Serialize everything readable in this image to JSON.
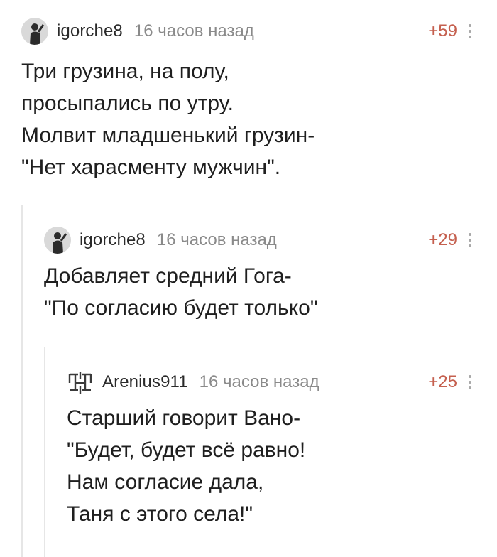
{
  "comments": [
    {
      "username": "igorche8",
      "time": "16 часов назад",
      "score": "+59",
      "avatar": "user-photo-avatar",
      "lines": [
        "Три грузина, на полу,",
        "просыпались по утру.",
        "Молвит младшенький грузин-",
        "\"Нет харасменту мужчин\"."
      ]
    },
    {
      "username": "igorche8",
      "time": "16 часов назад",
      "score": "+29",
      "avatar": "user-photo-avatar",
      "lines": [
        "Добавляет средний Гога-",
        "\"По согласию будет только\""
      ]
    },
    {
      "username": "Arenius911",
      "time": "16 часов назад",
      "score": "+25",
      "avatar": "band-logo-avatar",
      "lines": [
        "Старший говорит Вано-",
        "\"Будет, будет всё равно!",
        "Нам согласие дала,",
        "Таня с этого села!\""
      ]
    }
  ],
  "colors": {
    "score": "#c5604f",
    "time": "#8a8a8a",
    "thread_line": "#e6e6e6"
  }
}
